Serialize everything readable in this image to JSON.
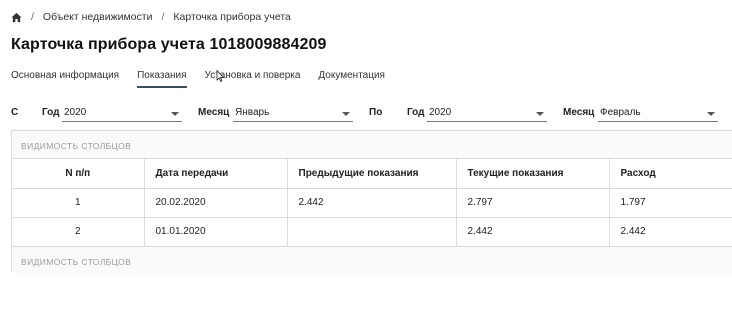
{
  "breadcrumb": {
    "home_icon": "home-icon",
    "separator": "/",
    "items": [
      "Объект недвижимости",
      "Карточка прибора учета"
    ]
  },
  "page": {
    "title": "Карточка прибора учета 1018009884209"
  },
  "tabs": [
    {
      "label": "Основная информация",
      "active": false
    },
    {
      "label": "Показания",
      "active": true
    },
    {
      "label": "Установка и поверка",
      "active": false
    },
    {
      "label": "Документация",
      "active": false
    }
  ],
  "filters": {
    "from_label": "С",
    "to_label": "По",
    "from_year_label": "Год",
    "from_year_value": "2020",
    "from_month_label": "Месяц",
    "from_month_value": "Январь",
    "to_year_label": "Год",
    "to_year_value": "2020",
    "to_month_label": "Месяц",
    "to_month_value": "Февраль"
  },
  "table": {
    "visibility_label": "Видимость столбцов",
    "columns": [
      "N п/п",
      "Дата передачи",
      "Предыдущие показания",
      "Текущие показания",
      "Расход"
    ],
    "rows": [
      [
        "1",
        "20.02.2020",
        "2.442",
        "2.797",
        "1.797"
      ],
      [
        "2",
        "01.01.2020",
        "",
        "2.442",
        "2.442"
      ]
    ]
  },
  "colors": {
    "active_tab_underline": "#3a4f5c",
    "border": "#dcdcdc",
    "muted_text": "#9a9a9a"
  }
}
